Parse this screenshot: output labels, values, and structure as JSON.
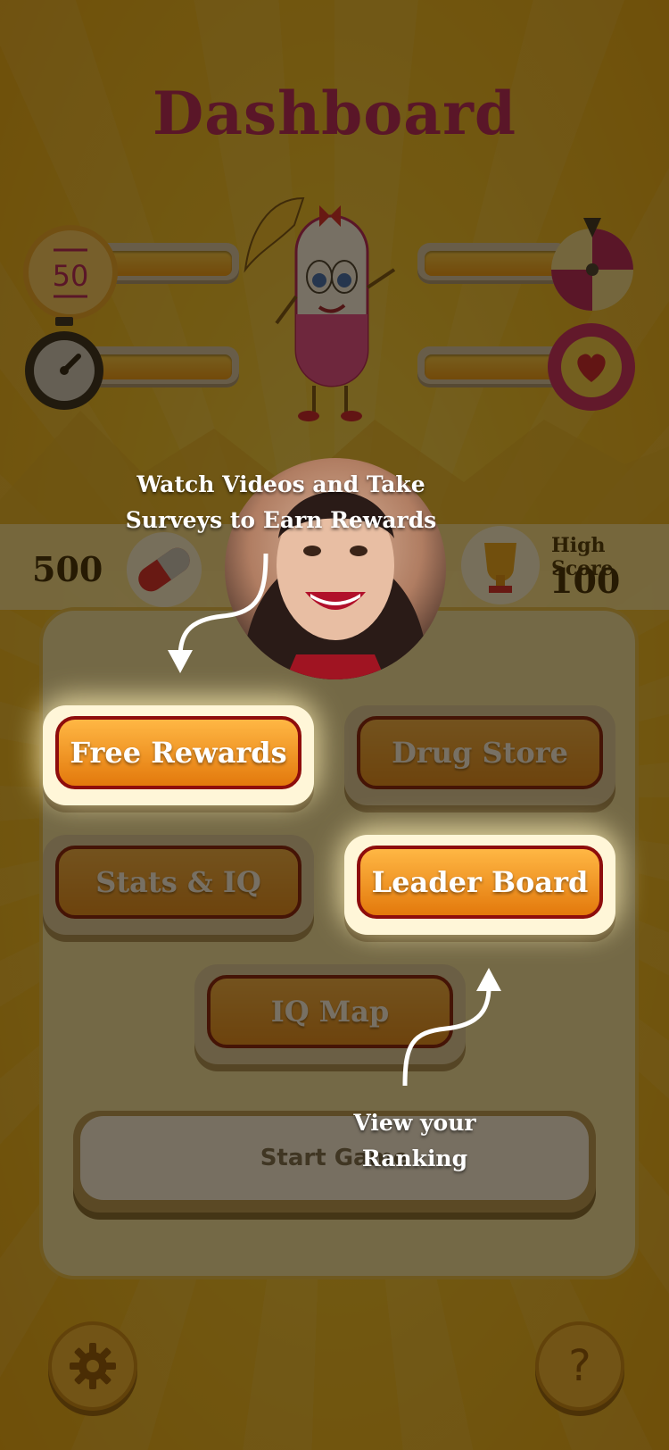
{
  "screen": {
    "title": "Dashboard"
  },
  "stats": {
    "pills_count": "500",
    "high_score_label": "High Score",
    "high_score_value": "100",
    "timer_badge": "50"
  },
  "menu": {
    "free_rewards": "Free Rewards",
    "drug_store": "Drug Store",
    "stats_iq": "Stats & IQ",
    "leader_board": "Leader Board",
    "iq_map": "IQ Map",
    "start_game": "Start Game"
  },
  "tutorial": {
    "rewards_tip_line1": "Watch Videos and Take",
    "rewards_tip_line2": "Surveys to Earn Rewards",
    "ranking_tip_line1": "View your",
    "ranking_tip_line2": "Ranking"
  },
  "footer": {
    "help_symbol": "?"
  },
  "colors": {
    "title": "#b21461",
    "button_orange": "#ffb744",
    "button_border": "#7c0f0a",
    "background": "#f2c52a"
  }
}
